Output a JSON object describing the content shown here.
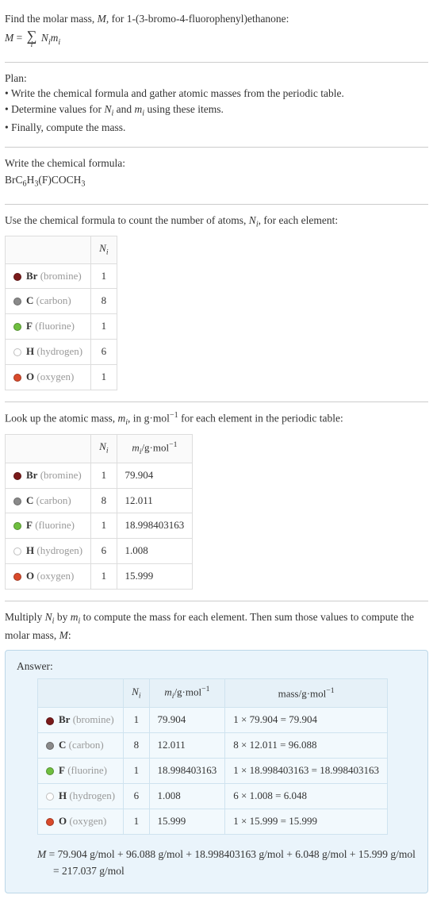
{
  "intro": {
    "find_line_pre": "Find the molar mass, ",
    "find_line_var": "M",
    "find_line_post": ", for 1-(3-bromo-4-fluorophenyl)ethanone:",
    "eq_M": "M",
    "eq_eqsign": " = ",
    "eq_Ni": "N",
    "eq_i": "i",
    "eq_mi": "m"
  },
  "plan": {
    "heading": "Plan:",
    "b1": "• Write the chemical formula and gather atomic masses from the periodic table.",
    "b2_pre": "• Determine values for ",
    "b2_mid": " and ",
    "b2_post": " using these items.",
    "b3": "• Finally, compute the mass."
  },
  "formula_sec": {
    "heading": "Write the chemical formula:",
    "f_BrC": "BrC",
    "f_6": "6",
    "f_H": "H",
    "f_3a": "3",
    "f_FCOCH": "(F)COCH",
    "f_3b": "3"
  },
  "count_sec": {
    "heading_pre": "Use the chemical formula to count the number of atoms, ",
    "heading_post": ", for each element:",
    "col_Ni_N": "N",
    "col_Ni_i": "i"
  },
  "lookup_sec": {
    "heading_pre": "Look up the atomic mass, ",
    "heading_mid": ", in g·mol",
    "heading_sup": "−1",
    "heading_post": " for each element in the periodic table:",
    "col_mi_m": "m",
    "col_mi_i": "i",
    "col_mi_unit_pre": "/g·mol",
    "col_mi_unit_sup": "−1"
  },
  "mult_sec": {
    "heading_a": "Multiply ",
    "heading_b": " by ",
    "heading_c": " to compute the mass for each element. Then sum those values to compute the molar mass, ",
    "heading_d": ":"
  },
  "answer": {
    "label": "Answer:",
    "col_mass_pre": "mass/g·mol",
    "col_mass_sup": "−1",
    "final_pre": "M",
    "final_eq": " = 79.904 g/mol + 96.088 g/mol + 18.998403163 g/mol + 6.048 g/mol + 15.999 g/mol = 217.037 g/mol"
  },
  "elements": [
    {
      "sym": "Br",
      "name": "(bromine)",
      "color": "#7a1a1a",
      "n": "1",
      "m": "79.904",
      "mass": "1 × 79.904 = 79.904"
    },
    {
      "sym": "C",
      "name": "(carbon)",
      "color": "#8a8a8a",
      "n": "8",
      "m": "12.011",
      "mass": "8 × 12.011 = 96.088"
    },
    {
      "sym": "F",
      "name": "(fluorine)",
      "color": "#6fbf3f",
      "n": "1",
      "m": "18.998403163",
      "mass": "1 × 18.998403163 = 18.998403163"
    },
    {
      "sym": "H",
      "name": "(hydrogen)",
      "color": "#ffffff",
      "n": "6",
      "m": "1.008",
      "mass": "6 × 1.008 = 6.048"
    },
    {
      "sym": "O",
      "name": "(oxygen)",
      "color": "#d94a2b",
      "n": "1",
      "m": "15.999",
      "mass": "1 × 15.999 = 15.999"
    }
  ]
}
